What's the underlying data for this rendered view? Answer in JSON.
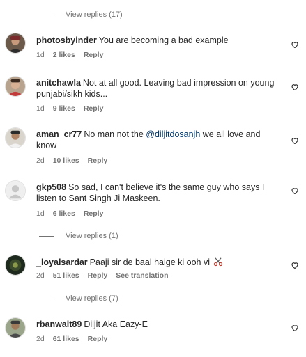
{
  "comments": [
    {
      "username": "photosbyinder",
      "text": "You are becoming a bad example",
      "time": "1d",
      "likes": "2 likes",
      "reply": "Reply",
      "avatar_icon": "user-avatar-icon"
    },
    {
      "username": "anitchawla",
      "text": "Not at all good. Leaving bad impression on young punjabi/sikh kids...",
      "time": "1d",
      "likes": "9 likes",
      "reply": "Reply",
      "avatar_icon": "user-avatar-icon"
    },
    {
      "username": "aman_cr77",
      "text_before": "No man not the ",
      "mention": "@diljitdosanjh",
      "text_after": " we all love and know",
      "time": "2d",
      "likes": "10 likes",
      "reply": "Reply",
      "avatar_icon": "user-avatar-icon"
    },
    {
      "username": "gkp508",
      "text": "So sad, I can't believe it's the same guy who says I listen to Sant Singh Ji Maskeen.",
      "time": "1d",
      "likes": "6 likes",
      "reply": "Reply",
      "avatar_icon": "default-avatar-icon"
    },
    {
      "username": "_loyalsardar",
      "text": "Paaji sir de baal haige ki ooh vi",
      "emoji_icon": "scissors-emoji-icon",
      "time": "2d",
      "likes": "51 likes",
      "reply": "Reply",
      "translation": "See translation",
      "avatar_icon": "user-avatar-icon"
    },
    {
      "username": "rbanwait89",
      "text": "Diljit Aka Eazy-E",
      "time": "2d",
      "likes": "61 likes",
      "reply": "Reply",
      "avatar_icon": "user-avatar-icon"
    }
  ],
  "view_replies": {
    "top": "View replies (17)",
    "after_loyalsardar_pre": "View replies (1)",
    "after_loyalsardar": "View replies (7)"
  },
  "colors": {
    "text": "#262626",
    "secondary": "#737373",
    "mention": "#00376b"
  },
  "icons": {
    "like": "heart-outline-icon"
  }
}
